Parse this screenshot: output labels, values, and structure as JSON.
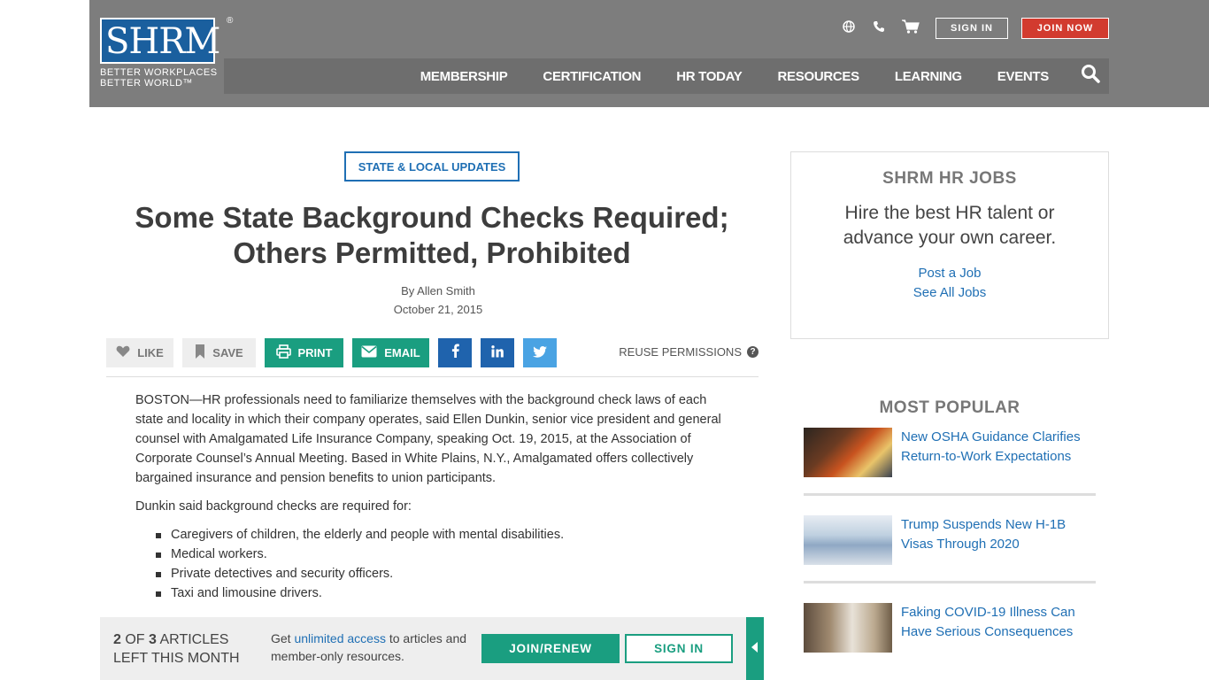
{
  "header": {
    "logo_text": "SHRM",
    "logo_reg": "®",
    "logo_tagline_1": "BETTER WORKPLACES",
    "logo_tagline_2": "BETTER WORLD™",
    "sign_in": "SIGN IN",
    "join_now": "JOIN NOW",
    "icons": [
      "globe-icon",
      "phone-icon",
      "cart-icon"
    ],
    "nav": [
      "MEMBERSHIP",
      "CERTIFICATION",
      "HR TODAY",
      "RESOURCES",
      "LEARNING",
      "EVENTS"
    ]
  },
  "article": {
    "tag": "STATE & LOCAL UPDATES",
    "title": "Some State Background Checks Required; Others Permitted, Prohibited",
    "author": "By Allen Smith",
    "date": "October 21, 2015",
    "share": {
      "like": "LIKE",
      "save": "SAVE",
      "print": "PRINT",
      "email": "EMAIL",
      "reuse": "REUSE PERMISSIONS"
    },
    "paragraph_1": "BOSTON—HR professionals need to familiarize themselves with the background check laws of each state and locality in which their company operates, said Ellen Dunkin, senior vice president and general counsel with Amalgamated Life Insurance Company, speaking Oct. 19, 2015, at the Association of Corporate Counsel’s Annual Meeting. Based in White Plains, N.Y., Amalgamated offers collectively bargained insurance and pension benefits to union participants.",
    "paragraph_2": "Dunkin said background checks are required for:",
    "list": [
      "Caregivers of children, the elderly and people with mental disabilities.",
      "Medical workers.",
      "Private detectives and security officers.",
      "Taxi and limousine drivers."
    ]
  },
  "sidebar": {
    "jobs_title": "SHRM HR JOBS",
    "jobs_subtitle": "Hire the best HR talent or advance your own career.",
    "post_job": "Post a Job",
    "see_jobs": "See All Jobs",
    "most_popular": "MOST POPULAR",
    "popular": [
      "New OSHA Guidance Clarifies Return-to-Work Expectations",
      "Trump Suspends New H-1B Visas Through 2020",
      "Faking COVID-19 Illness Can Have Serious Consequences"
    ]
  },
  "meter": {
    "count": "2",
    "of": "OF",
    "total": "3",
    "label_1": "ARTICLES",
    "label_2": "LEFT THIS MONTH",
    "msg_pre": "Get",
    "msg_link": "unlimited access",
    "msg_post": "to articles and member-only resources.",
    "join_renew": "JOIN/RENEW",
    "sign_in": "SIGN IN"
  },
  "colors": {
    "header_bg": "#7d7d7d",
    "accent_green": "#1a9e80",
    "link_blue": "#1f6fb4",
    "join_red": "#d23b2f"
  }
}
